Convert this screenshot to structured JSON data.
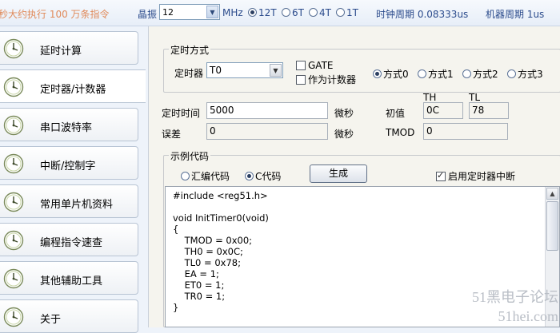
{
  "topbar": {
    "slogan": "秒大约执行 100 万条指令",
    "crystal_label": "晶振",
    "crystal_value": "12",
    "crystal_unit": "MHz",
    "modes": [
      {
        "label": "12T",
        "selected": true
      },
      {
        "label": "6T",
        "selected": false
      },
      {
        "label": "4T",
        "selected": false
      },
      {
        "label": "1T",
        "selected": false
      }
    ],
    "clock_cycle": "时钟周期 0.08333us",
    "machine_cycle": "机器周期 1us"
  },
  "sidebar": {
    "items": [
      {
        "label": "延时计算",
        "icon": "clock-icon",
        "active": false
      },
      {
        "label": "定时器/计数器",
        "icon": "clock-icon",
        "active": true
      },
      {
        "label": "串口波特率",
        "icon": "clock-icon",
        "active": false
      },
      {
        "label": "中断/控制字",
        "icon": "clock-icon",
        "active": false
      },
      {
        "label": "常用单片机资料",
        "icon": "clock-icon",
        "active": false
      },
      {
        "label": "编程指令速查",
        "icon": "clock-icon",
        "active": false
      },
      {
        "label": "其他辅助工具",
        "icon": "clock-icon",
        "active": false
      },
      {
        "label": "关于",
        "icon": "clock-icon",
        "active": false
      }
    ]
  },
  "timer_mode": {
    "title": "定时方式",
    "timer_label": "定时器",
    "timer_value": "T0",
    "gate_label": "GATE",
    "counter_label": "作为计数器",
    "modes": [
      {
        "label": "方式0",
        "selected": true
      },
      {
        "label": "方式1",
        "selected": false
      },
      {
        "label": "方式2",
        "selected": false
      },
      {
        "label": "方式3",
        "selected": false
      }
    ]
  },
  "timing": {
    "time_label": "定时时间",
    "time_value": "5000",
    "time_unit": "微秒",
    "init_label": "初值",
    "th_label": "TH",
    "tl_label": "TL",
    "th_value": "0C",
    "tl_value": "78",
    "error_label": "误差",
    "error_value": "0",
    "error_unit": "微秒",
    "tmod_label": "TMOD",
    "tmod_value": "0"
  },
  "example": {
    "title": "示例代码",
    "asm_label": "汇编代码",
    "c_label": "C代码",
    "generate_label": "生成",
    "enable_int_label": "启用定时器中断",
    "code": "#include <reg51.h>\n\nvoid InitTimer0(void)\n{\n    TMOD = 0x00;\n    TH0 = 0x0C;\n    TL0 = 0x78;\n    EA = 1;\n    ET0 = 1;\n    TR0 = 1;\n}"
  },
  "watermark": {
    "line1": "51黑电子论坛",
    "line2": "51hei.com"
  }
}
